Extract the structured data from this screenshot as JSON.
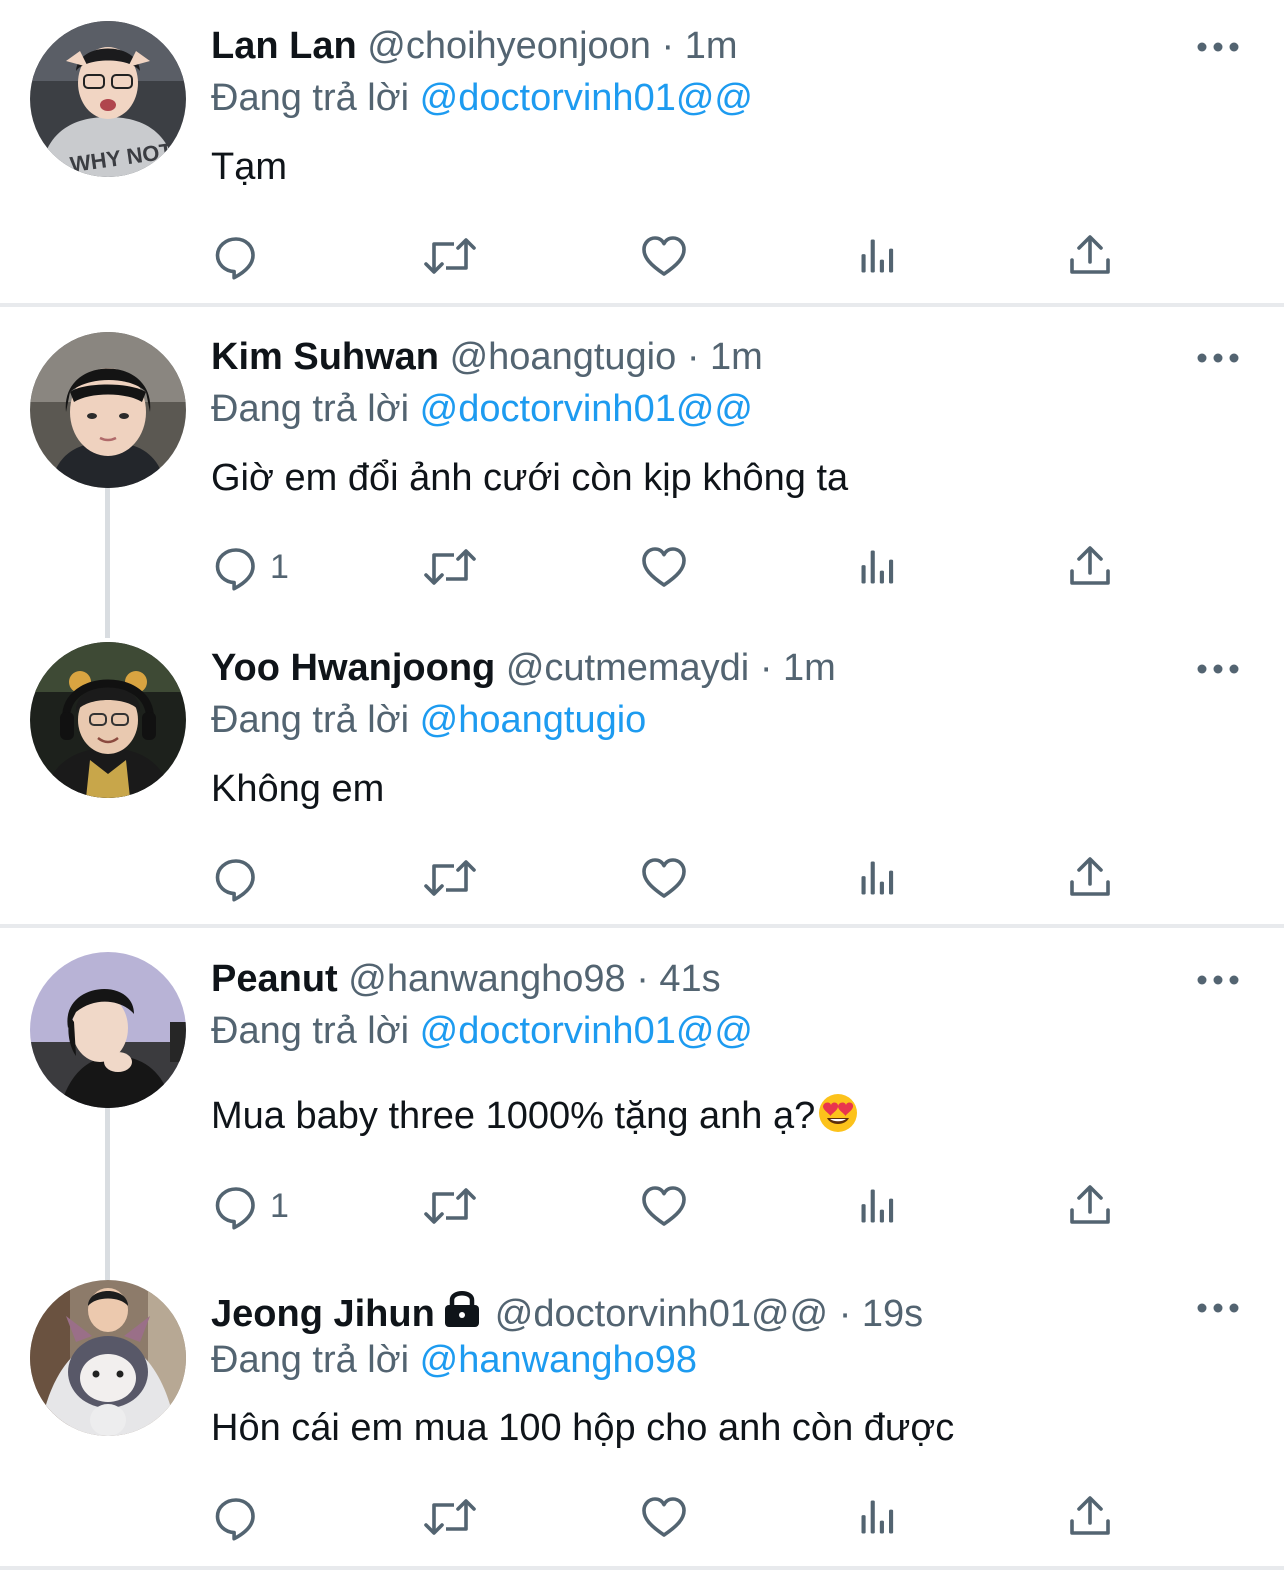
{
  "colors": {
    "text": "#0f1419",
    "secondary": "#536471",
    "mention": "#1d9bf0",
    "divider": "#e8eaed",
    "thread_line": "#d9dde1"
  },
  "icons": {
    "more": "more-horizontal-icon",
    "reply": "reply-icon",
    "retweet": "retweet-icon",
    "like": "heart-icon",
    "views": "views-icon",
    "share": "share-icon",
    "lock": "lock-icon",
    "emoji": "heart-eyes-emoji"
  },
  "tweets": [
    {
      "name": "Lan Lan",
      "handle": "@choihyeonjoon",
      "separator": "·",
      "time": "1m",
      "reply_prefix": "Đang trả lời",
      "reply_to": "@doctorvinh01@@",
      "text": "Tạm",
      "reply_count": ""
    },
    {
      "name": "Kim Suhwan",
      "handle": "@hoangtugio",
      "separator": "·",
      "time": "1m",
      "reply_prefix": "Đang trả lời",
      "reply_to": "@doctorvinh01@@",
      "text": "Giờ em đổi ảnh cưới còn kịp không ta",
      "reply_count": "1"
    },
    {
      "name": "Yoo Hwanjoong",
      "handle": "@cutmemaydi",
      "separator": "·",
      "time": "1m",
      "reply_prefix": "Đang trả lời",
      "reply_to": "@hoangtugio",
      "text": "Không em",
      "reply_count": ""
    },
    {
      "name": "Peanut",
      "handle": "@hanwangho98",
      "separator": "·",
      "time": "41s",
      "reply_prefix": "Đang trả lời",
      "reply_to": "@doctorvinh01@@",
      "text": "Mua baby three 1000% tặng anh ạ?",
      "reply_count": "1"
    },
    {
      "name": "Jeong Jihun",
      "handle": "@doctorvinh01@@",
      "separator": "·",
      "time": "19s",
      "reply_prefix": "Đang trả lời",
      "reply_to": "@hanwangho98",
      "text": "Hôn cái em mua 100 hộp cho anh còn được",
      "reply_count": ""
    }
  ]
}
